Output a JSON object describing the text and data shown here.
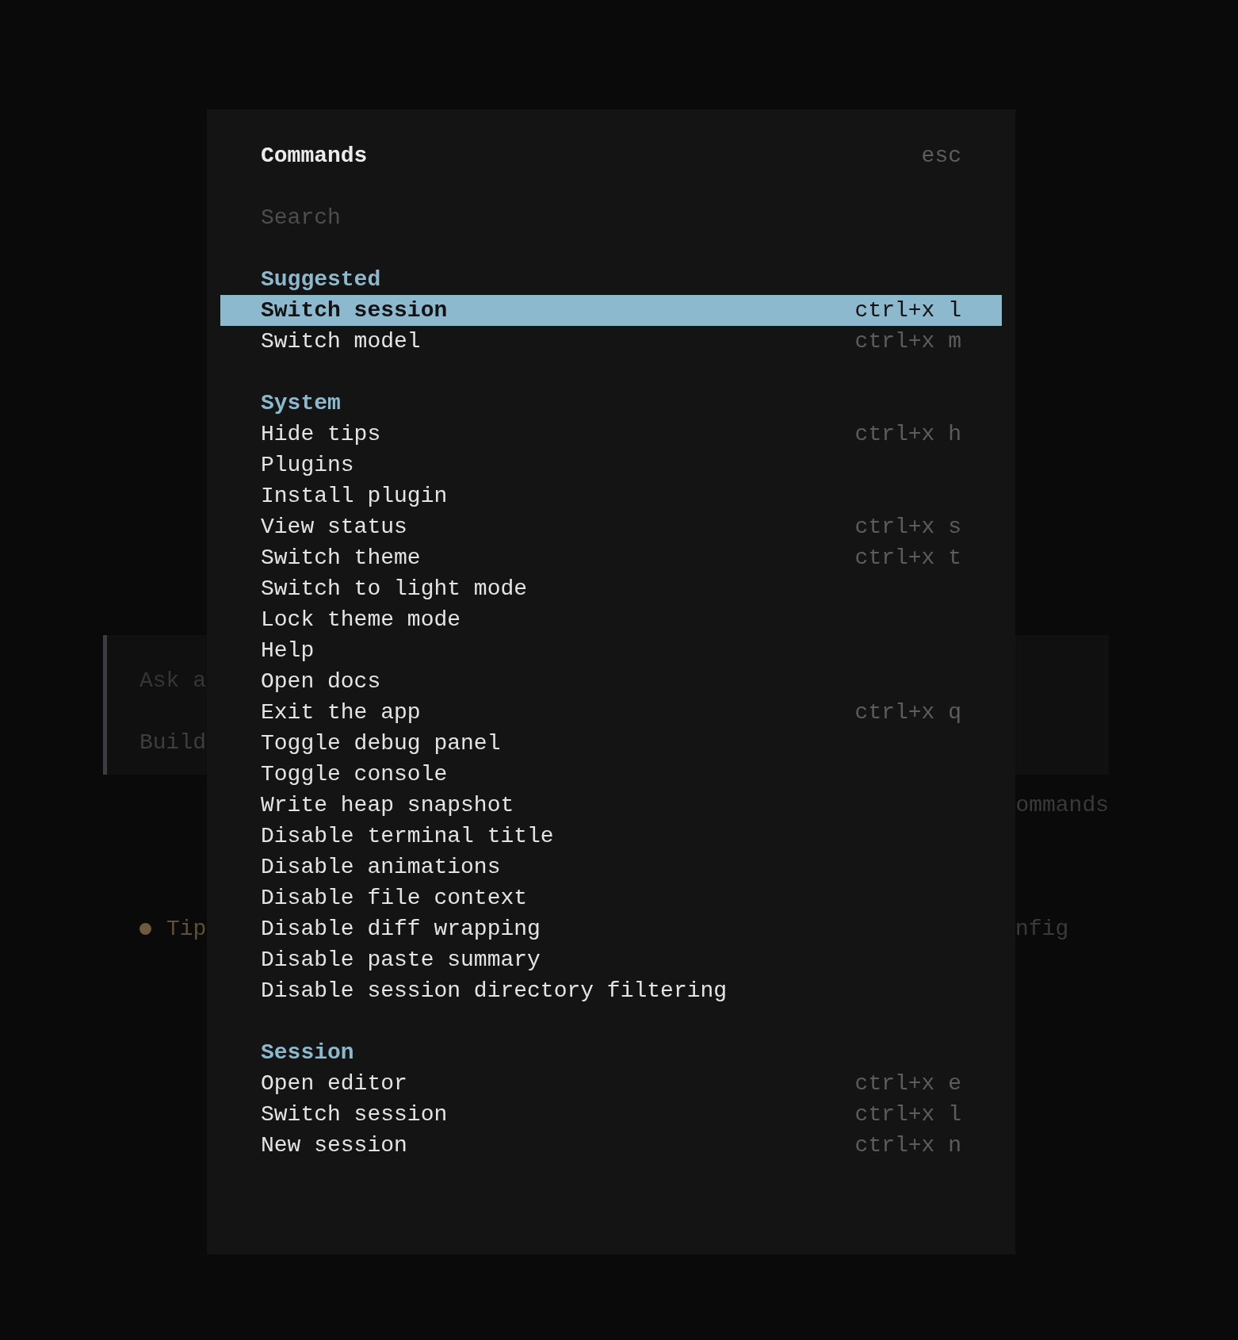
{
  "background": {
    "prompt_box": {
      "prompt_text": "Ask a",
      "mode": "Build"
    },
    "hint": "ommands",
    "tip": {
      "label": "Tip",
      "text": "nfig"
    }
  },
  "dialog": {
    "title": "Commands",
    "close_key": "esc",
    "search": {
      "placeholder": "Search"
    },
    "groups": [
      {
        "title": "Suggested",
        "items": [
          {
            "label": "Switch session",
            "shortcut": "ctrl+x l",
            "selected": true
          },
          {
            "label": "Switch model",
            "shortcut": "ctrl+x m",
            "selected": false
          }
        ]
      },
      {
        "title": "System",
        "items": [
          {
            "label": "Hide tips",
            "shortcut": "ctrl+x h",
            "selected": false
          },
          {
            "label": "Plugins",
            "selected": false
          },
          {
            "label": "Install plugin",
            "selected": false
          },
          {
            "label": "View status",
            "shortcut": "ctrl+x s",
            "selected": false
          },
          {
            "label": "Switch theme",
            "shortcut": "ctrl+x t",
            "selected": false
          },
          {
            "label": "Switch to light mode",
            "selected": false
          },
          {
            "label": "Lock theme mode",
            "selected": false
          },
          {
            "label": "Help",
            "selected": false
          },
          {
            "label": "Open docs",
            "selected": false
          },
          {
            "label": "Exit the app",
            "shortcut": "ctrl+x q",
            "selected": false
          },
          {
            "label": "Toggle debug panel",
            "selected": false
          },
          {
            "label": "Toggle console",
            "selected": false
          },
          {
            "label": "Write heap snapshot",
            "selected": false
          },
          {
            "label": "Disable terminal title",
            "selected": false
          },
          {
            "label": "Disable animations",
            "selected": false
          },
          {
            "label": "Disable file context",
            "selected": false
          },
          {
            "label": "Disable diff wrapping",
            "selected": false
          },
          {
            "label": "Disable paste summary",
            "selected": false
          },
          {
            "label": "Disable session directory filtering",
            "selected": false
          }
        ]
      },
      {
        "title": "Session",
        "items": [
          {
            "label": "Open editor",
            "shortcut": "ctrl+x e",
            "selected": false
          },
          {
            "label": "Switch session",
            "shortcut": "ctrl+x l",
            "selected": false
          },
          {
            "label": "New session",
            "shortcut": "ctrl+x n",
            "selected": false
          }
        ]
      }
    ]
  }
}
